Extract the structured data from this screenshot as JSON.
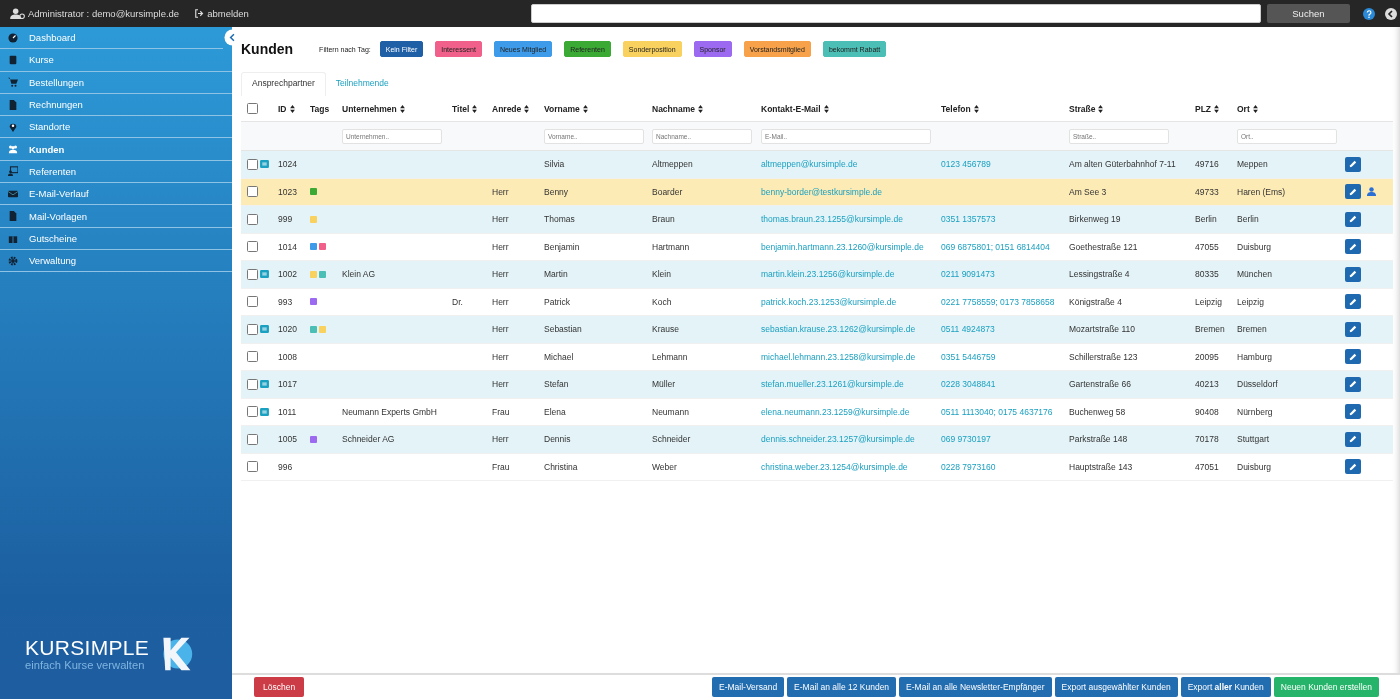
{
  "topbar": {
    "user": "Administrator : demo@kursimple.de",
    "logout": "abmelden",
    "search_button": "Suchen"
  },
  "sidebar": {
    "items": [
      {
        "label": "Dashboard",
        "selected": false
      },
      {
        "label": "Kurse",
        "selected": false
      },
      {
        "label": "Bestellungen",
        "selected": false
      },
      {
        "label": "Rechnungen",
        "selected": false
      },
      {
        "label": "Standorte",
        "selected": false
      },
      {
        "label": "Kunden",
        "selected": true
      },
      {
        "label": "Referenten",
        "selected": false
      },
      {
        "label": "E-Mail-Verlauf",
        "selected": false
      },
      {
        "label": "Mail-Vorlagen",
        "selected": false
      },
      {
        "label": "Gutscheine",
        "selected": false
      },
      {
        "label": "Verwaltung",
        "selected": false
      }
    ],
    "logo": {
      "name": "KURSIMPLE",
      "slogan": "einfach Kurse verwalten"
    }
  },
  "page": {
    "title": "Kunden",
    "filter_label": "Filtern nach Tag:"
  },
  "filters": [
    {
      "label": "Kein Filter",
      "color": "#1f5fa6",
      "selected": true
    },
    {
      "label": "Interessent",
      "color": "#f0608a",
      "selected": false
    },
    {
      "label": "Neues Mitglied",
      "color": "#3d9be9",
      "selected": false
    },
    {
      "label": "Referenten",
      "color": "#3aaa35",
      "selected": false
    },
    {
      "label": "Sonderposition",
      "color": "#f9d15e",
      "selected": false
    },
    {
      "label": "Sponsor",
      "color": "#9b6af0",
      "selected": false
    },
    {
      "label": "Vorstandsmitglied",
      "color": "#f7a24a",
      "selected": false
    },
    {
      "label": "bekommt Rabatt",
      "color": "#4bbfb5",
      "selected": false
    }
  ],
  "tabs": [
    {
      "label": "Ansprechpartner",
      "selected": true
    },
    {
      "label": "Teilnehmende",
      "selected": false
    }
  ],
  "table": {
    "select_all": {
      "checked": false
    },
    "columns": [
      {
        "label": "ID",
        "sortable": true
      },
      {
        "label": "Tags",
        "sortable": false
      },
      {
        "label": "Unternehmen",
        "sortable": true,
        "placeholder": "Unternehmen.."
      },
      {
        "label": "Titel",
        "sortable": true
      },
      {
        "label": "Anrede",
        "sortable": true
      },
      {
        "label": "Vorname",
        "sortable": true,
        "placeholder": "Vorname.."
      },
      {
        "label": "Nachname",
        "sortable": true,
        "placeholder": "Nachname.."
      },
      {
        "label": "Kontakt-E-Mail",
        "sortable": true,
        "placeholder": "E-Mail.."
      },
      {
        "label": "Telefon",
        "sortable": true
      },
      {
        "label": "Straße",
        "sortable": true,
        "placeholder": "Straße.."
      },
      {
        "label": "PLZ",
        "sortable": true
      },
      {
        "label": "Ort",
        "sortable": true,
        "placeholder": "Ort.."
      }
    ],
    "rows": [
      {
        "checked": false,
        "newsletter": true,
        "highlighted": false,
        "account": false,
        "cells": [
          "1024",
          "",
          "",
          "",
          "",
          "Silvia",
          "Altmeppen",
          "altmeppen@kursimple.de",
          "0123 456789",
          "Am alten Güterbahnhof 7-11",
          "49716",
          "Meppen"
        ],
        "tags": []
      },
      {
        "checked": false,
        "newsletter": false,
        "highlighted": true,
        "account": true,
        "cells": [
          "1023",
          "",
          "",
          "",
          "Herr",
          "Benny",
          "Boarder",
          "benny-border@testkursimple.de",
          "",
          "Am See 3",
          "49733",
          "Haren (Ems)"
        ],
        "tags": [
          {
            "color": "#3aaa35"
          }
        ]
      },
      {
        "checked": false,
        "newsletter": false,
        "highlighted": false,
        "account": false,
        "cells": [
          "999",
          "",
          "",
          "",
          "Herr",
          "Thomas",
          "Braun",
          "thomas.braun.23.1255@kursimple.de",
          "0351 1357573",
          "Birkenweg 19",
          "Berlin",
          "Berlin"
        ],
        "tags": [
          {
            "color": "#f9d15e"
          }
        ]
      },
      {
        "checked": false,
        "newsletter": false,
        "highlighted": false,
        "account": false,
        "cells": [
          "1014",
          "",
          "",
          "",
          "Herr",
          "Benjamin",
          "Hartmann",
          "benjamin.hartmann.23.1260@kursimple.de",
          "069 6875801; 0151 6814404",
          "Goethestraße 121",
          "47055",
          "Duisburg"
        ],
        "tags": [
          {
            "color": "#3d9be9"
          },
          {
            "color": "#f0608a"
          }
        ]
      },
      {
        "checked": false,
        "newsletter": true,
        "highlighted": false,
        "account": false,
        "cells": [
          "1002",
          "",
          "Klein AG",
          "",
          "Herr",
          "Martin",
          "Klein",
          "martin.klein.23.1256@kursimple.de",
          "0211 9091473",
          "Lessingstraße 4",
          "80335",
          "München"
        ],
        "tags": [
          {
            "color": "#f9d15e"
          },
          {
            "color": "#4bbfb5"
          }
        ]
      },
      {
        "checked": false,
        "newsletter": false,
        "highlighted": false,
        "account": false,
        "cells": [
          "993",
          "",
          "",
          "Dr.",
          "Herr",
          "Patrick",
          "Koch",
          "patrick.koch.23.1253@kursimple.de",
          "0221 7758559; 0173 7858658",
          "Königstraße 4",
          "Leipzig",
          "Leipzig"
        ],
        "tags": [
          {
            "color": "#9b6af0"
          }
        ]
      },
      {
        "checked": false,
        "newsletter": true,
        "highlighted": false,
        "account": false,
        "cells": [
          "1020",
          "",
          "",
          "",
          "Herr",
          "Sebastian",
          "Krause",
          "sebastian.krause.23.1262@kursimple.de",
          "0511 4924873",
          "Mozartstraße 110",
          "Bremen",
          "Bremen"
        ],
        "tags": [
          {
            "color": "#4bbfb5"
          },
          {
            "color": "#f9d15e"
          }
        ]
      },
      {
        "checked": false,
        "newsletter": false,
        "highlighted": false,
        "account": false,
        "cells": [
          "1008",
          "",
          "",
          "",
          "Herr",
          "Michael",
          "Lehmann",
          "michael.lehmann.23.1258@kursimple.de",
          "0351 5446759",
          "Schillerstraße 123",
          "20095",
          "Hamburg"
        ],
        "tags": []
      },
      {
        "checked": false,
        "newsletter": true,
        "highlighted": false,
        "account": false,
        "cells": [
          "1017",
          "",
          "",
          "",
          "Herr",
          "Stefan",
          "Müller",
          "stefan.mueller.23.1261@kursimple.de",
          "0228 3048841",
          "Gartenstraße 66",
          "40213",
          "Düsseldorf"
        ],
        "tags": []
      },
      {
        "checked": false,
        "newsletter": true,
        "highlighted": false,
        "account": false,
        "cells": [
          "1011",
          "",
          "Neumann Experts GmbH",
          "",
          "Frau",
          "Elena",
          "Neumann",
          "elena.neumann.23.1259@kursimple.de",
          "0511 1113040; 0175 4637176",
          "Buchenweg 58",
          "90408",
          "Nürnberg"
        ],
        "tags": []
      },
      {
        "checked": false,
        "newsletter": false,
        "highlighted": false,
        "account": false,
        "cells": [
          "1005",
          "",
          "Schneider AG",
          "",
          "Herr",
          "Dennis",
          "Schneider",
          "dennis.schneider.23.1257@kursimple.de",
          "069 9730197",
          "Parkstraße 148",
          "70178",
          "Stuttgart"
        ],
        "tags": [
          {
            "color": "#9b6af0"
          }
        ]
      },
      {
        "checked": false,
        "newsletter": false,
        "highlighted": false,
        "account": false,
        "cells": [
          "996",
          "",
          "",
          "",
          "Frau",
          "Christina",
          "Weber",
          "christina.weber.23.1254@kursimple.de",
          "0228 7973160",
          "Hauptstraße 143",
          "47051",
          "Duisburg"
        ],
        "tags": []
      }
    ]
  },
  "footer": {
    "buttons": [
      {
        "label": "Löschen",
        "kind": "danger"
      },
      {
        "label": "E-Mail-Versand",
        "kind": "primary"
      },
      {
        "label": "E-Mail an alle 12 Kunden",
        "kind": "primary"
      },
      {
        "label": "E-Mail an alle Newsletter-Empfänger",
        "kind": "primary"
      },
      {
        "label": "Export ausgewählter Kunden",
        "kind": "primary"
      },
      {
        "label": "Export **aller** Kunden",
        "kind": "primary"
      },
      {
        "label": "Neuen Kunden erstellen",
        "kind": "success"
      }
    ]
  }
}
